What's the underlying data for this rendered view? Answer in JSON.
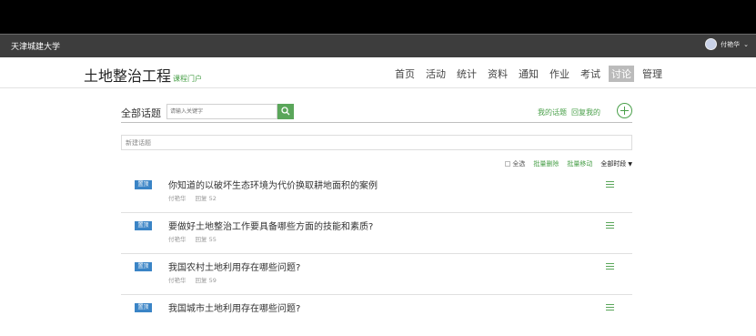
{
  "site": {
    "school": "天津城建大学",
    "user_name": "付艳华"
  },
  "course": {
    "title": "土地整治工程",
    "subtitle": "课程门户"
  },
  "nav": [
    {
      "label": "首页",
      "active": false
    },
    {
      "label": "活动",
      "active": false
    },
    {
      "label": "统计",
      "active": false
    },
    {
      "label": "资料",
      "active": false
    },
    {
      "label": "通知",
      "active": false
    },
    {
      "label": "作业",
      "active": false
    },
    {
      "label": "考试",
      "active": false
    },
    {
      "label": "讨论",
      "active": true
    },
    {
      "label": "管理",
      "active": false
    }
  ],
  "toolbar": {
    "title": "全部话题",
    "search_placeholder": "请输入关键字",
    "my_topics": "我的话题",
    "my_replies": "回复我的"
  },
  "new_topic_placeholder": "新建话题",
  "ops": {
    "select_all": "全选",
    "batch_delete": "批量删除",
    "batch_move": "批量移动",
    "sort": "全部时段"
  },
  "topics": [
    {
      "badge": "置顶",
      "title": "你知道的以破坏生态环境为代价换取耕地面积的案例",
      "author": "付艳华",
      "replies": "回复 52"
    },
    {
      "badge": "置顶",
      "title": "要做好土地整治工作要具备哪些方面的技能和素质?",
      "author": "付艳华",
      "replies": "回复 55"
    },
    {
      "badge": "置顶",
      "title": "我国农村土地利用存在哪些问题?",
      "author": "付艳华",
      "replies": "回复 59"
    },
    {
      "badge": "置顶",
      "title": "我国城市土地利用存在哪些问题?",
      "author": "",
      "replies": ""
    }
  ]
}
